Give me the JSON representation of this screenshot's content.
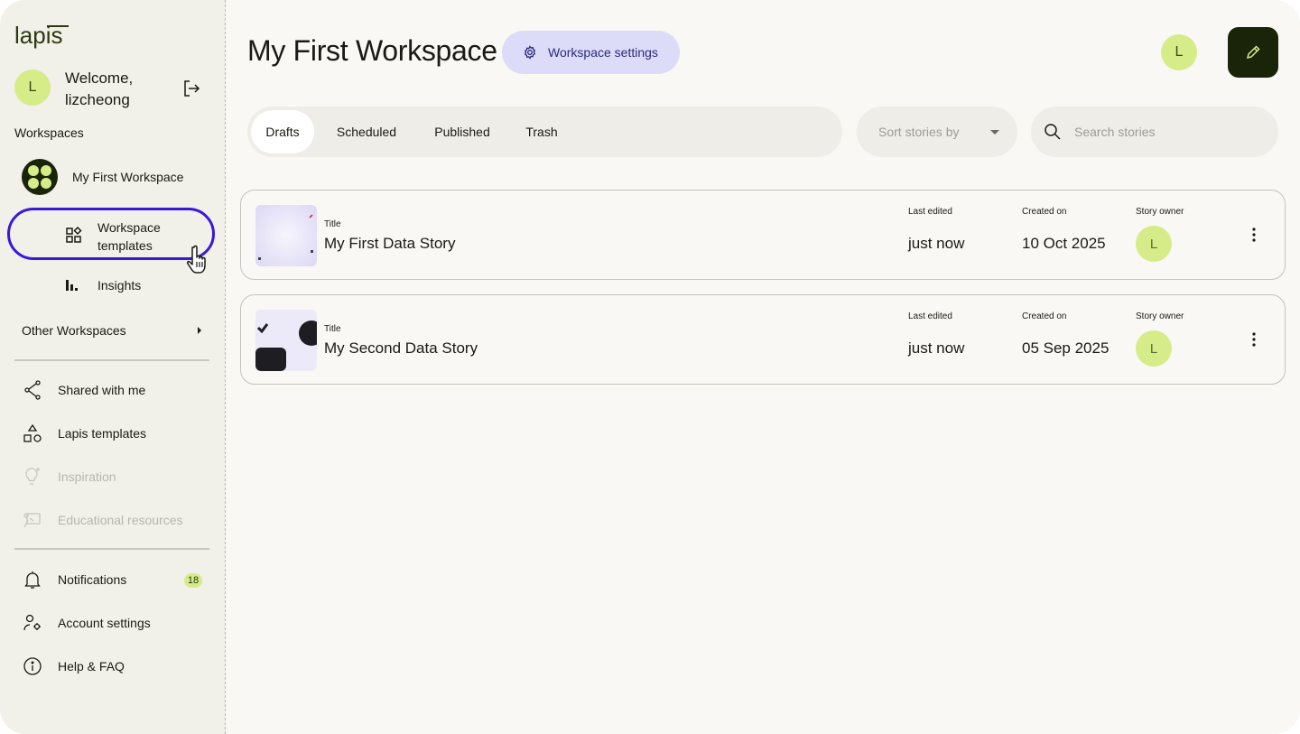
{
  "brand": {
    "logo_text": "lapis"
  },
  "user": {
    "initial": "L",
    "welcome": "Welcome,",
    "username": "lizcheong"
  },
  "sidebar": {
    "workspaces_title": "Workspaces",
    "current_workspace": "My First Workspace",
    "workspace_templates_line1": "Workspace",
    "workspace_templates_line2": "templates",
    "insights": "Insights",
    "other_workspaces": "Other Workspaces",
    "nav": [
      {
        "label": "Shared with me",
        "icon": "share-icon",
        "enabled": true
      },
      {
        "label": "Lapis templates",
        "icon": "shapes-icon",
        "enabled": true
      },
      {
        "label": "Inspiration",
        "icon": "lightbulb-icon",
        "enabled": false
      },
      {
        "label": "Educational resources",
        "icon": "education-icon",
        "enabled": false
      }
    ],
    "notifications": {
      "label": "Notifications",
      "count": "18"
    },
    "account_settings": "Account settings",
    "help": "Help & FAQ"
  },
  "header": {
    "title": "My First Workspace",
    "settings_button": "Workspace settings",
    "avatar_initial": "L"
  },
  "tabs": [
    {
      "label": "Drafts",
      "active": true
    },
    {
      "label": "Scheduled",
      "active": false
    },
    {
      "label": "Published",
      "active": false
    },
    {
      "label": "Trash",
      "active": false
    }
  ],
  "sort": {
    "placeholder": "Sort stories by"
  },
  "search": {
    "placeholder": "Search stories",
    "value": ""
  },
  "columns": {
    "title": "Title",
    "last_edited": "Last edited",
    "created_on": "Created on",
    "owner": "Story owner"
  },
  "stories": [
    {
      "title": "My First Data Story",
      "last_edited": "just now",
      "created_on": "10 Oct 2025",
      "owner_initial": "L"
    },
    {
      "title": "My Second Data Story",
      "last_edited": "just now",
      "created_on": "05 Sep 2025",
      "owner_initial": "L"
    }
  ],
  "colors": {
    "accent_lime": "#d6ec89",
    "highlight_ring": "#3a18d8",
    "settings_button_bg": "#dcdcf8",
    "edit_button_bg": "#1a2408"
  }
}
